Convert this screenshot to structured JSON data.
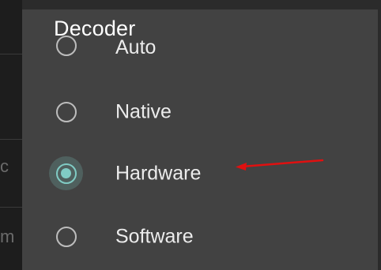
{
  "background_letters": {
    "left_1": "c",
    "left_2": "m"
  },
  "dialog": {
    "title": "Decoder",
    "options": [
      {
        "label": "Auto",
        "selected": false
      },
      {
        "label": "Native",
        "selected": false
      },
      {
        "label": "Hardware",
        "selected": true
      },
      {
        "label": "Software",
        "selected": false
      }
    ]
  },
  "colors": {
    "accent": "#80cbc4",
    "annotation_arrow": "#e01010",
    "dialog_bg": "#424242"
  }
}
